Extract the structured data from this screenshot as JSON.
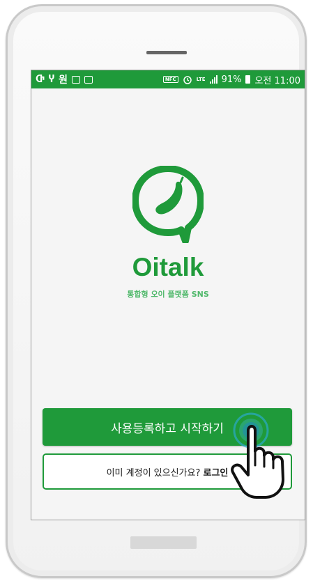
{
  "status_bar": {
    "left_glyphs": [
      "Ⴇ",
      "Ⴤ",
      "원"
    ],
    "nfc_label": "NFC",
    "network_label": "LTE",
    "battery_percent": "91%",
    "time": "오전 11:00"
  },
  "app": {
    "name": "Oitalk",
    "subtitle": "통합형 오이 플랫폼 SNS"
  },
  "buttons": {
    "register_label": "사용등록하고 시작하기",
    "login_prompt": "이미 계정이 있으신가요?",
    "login_link": "로그인"
  },
  "colors": {
    "brand_green": "#1f9a3a",
    "light_green": "#4fb86a",
    "screen_bg": "#f5f5f5"
  },
  "icons": [
    "app-logo-icon",
    "tap-hand-icon",
    "alarm-icon",
    "battery-icon",
    "signal-icon"
  ]
}
